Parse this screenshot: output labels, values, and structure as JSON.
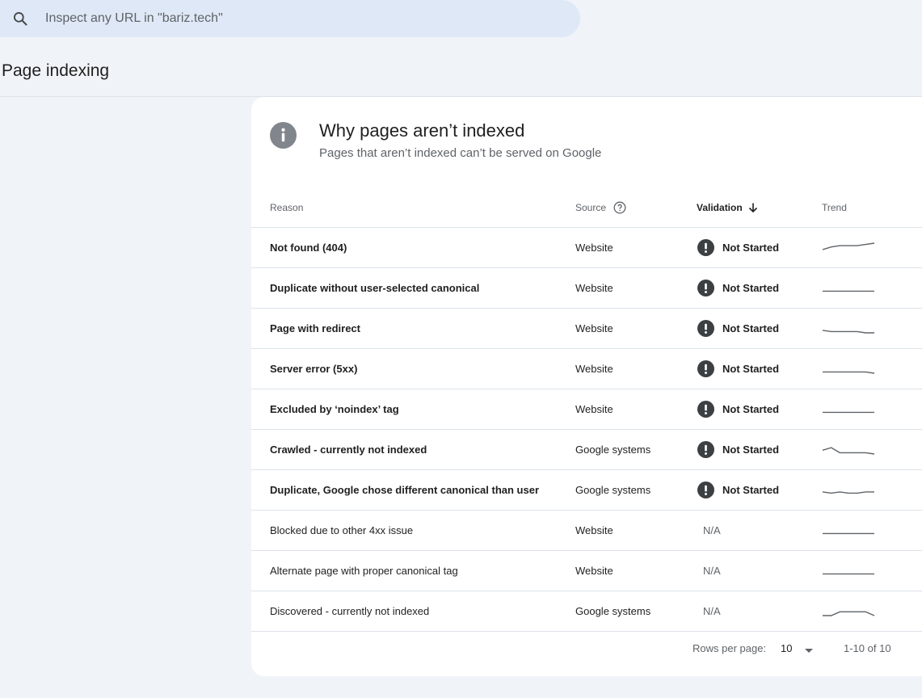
{
  "search": {
    "placeholder": "Inspect any URL in \"bariz.tech\""
  },
  "page": {
    "title": "Page indexing"
  },
  "card": {
    "title": "Why pages aren’t indexed",
    "subtitle": "Pages that aren’t indexed can’t be served on Google"
  },
  "table": {
    "headers": {
      "reason": "Reason",
      "source": "Source",
      "validation": "Validation",
      "trend": "Trend"
    },
    "rows": [
      {
        "reason": "Not found (404)",
        "source": "Website",
        "validation": "Not Started",
        "bold": true,
        "trend": [
          2,
          4,
          5,
          5,
          5,
          6,
          7
        ]
      },
      {
        "reason": "Duplicate without user-selected canonical",
        "source": "Website",
        "validation": "Not Started",
        "bold": true,
        "trend": [
          1,
          1,
          1,
          1,
          1,
          1,
          1
        ]
      },
      {
        "reason": "Page with redirect",
        "source": "Website",
        "validation": "Not Started",
        "bold": true,
        "trend": [
          2,
          1,
          1,
          1,
          1,
          0,
          0
        ]
      },
      {
        "reason": "Server error (5xx)",
        "source": "Website",
        "validation": "Not Started",
        "bold": true,
        "trend": [
          1,
          1,
          1,
          1,
          1,
          1,
          0
        ]
      },
      {
        "reason": "Excluded by ‘noindex’ tag",
        "source": "Website",
        "validation": "Not Started",
        "bold": true,
        "trend": [
          1,
          1,
          1,
          1,
          1,
          1,
          1
        ]
      },
      {
        "reason": "Crawled - currently not indexed",
        "source": "Google systems",
        "validation": "Not Started",
        "bold": true,
        "trend": [
          3,
          5,
          1,
          1,
          1,
          1,
          0
        ]
      },
      {
        "reason": "Duplicate, Google chose different canonical than user",
        "source": "Google systems",
        "validation": "Not Started",
        "bold": true,
        "trend": [
          2,
          1,
          2,
          1,
          1,
          2,
          2
        ]
      },
      {
        "reason": "Blocked due to other 4xx issue",
        "source": "Website",
        "validation": "N/A",
        "bold": false,
        "trend": [
          1,
          1,
          1,
          1,
          1,
          1,
          1
        ]
      },
      {
        "reason": "Alternate page with proper canonical tag",
        "source": "Website",
        "validation": "N/A",
        "bold": false,
        "trend": [
          1,
          1,
          1,
          1,
          1,
          1,
          1
        ]
      },
      {
        "reason": "Discovered - currently not indexed",
        "source": "Google systems",
        "validation": "N/A",
        "bold": false,
        "trend": [
          0,
          0,
          3,
          3,
          3,
          3,
          0
        ]
      }
    ]
  },
  "footer": {
    "rows_per_page_label": "Rows per page:",
    "rows_per_page_value": "10",
    "range": "1-10 of 10"
  },
  "colors": {
    "background": "#f0f4f9",
    "search_bg": "#dfe8f6",
    "status_icon": "#3c4043",
    "sparkline": "#5f6368"
  },
  "icons": {
    "search": "search-icon",
    "info": "info-icon",
    "help": "help-circle-icon",
    "sort": "arrow-down-icon",
    "status": "exclamation-circle-icon",
    "dropdown": "caret-down-icon"
  }
}
